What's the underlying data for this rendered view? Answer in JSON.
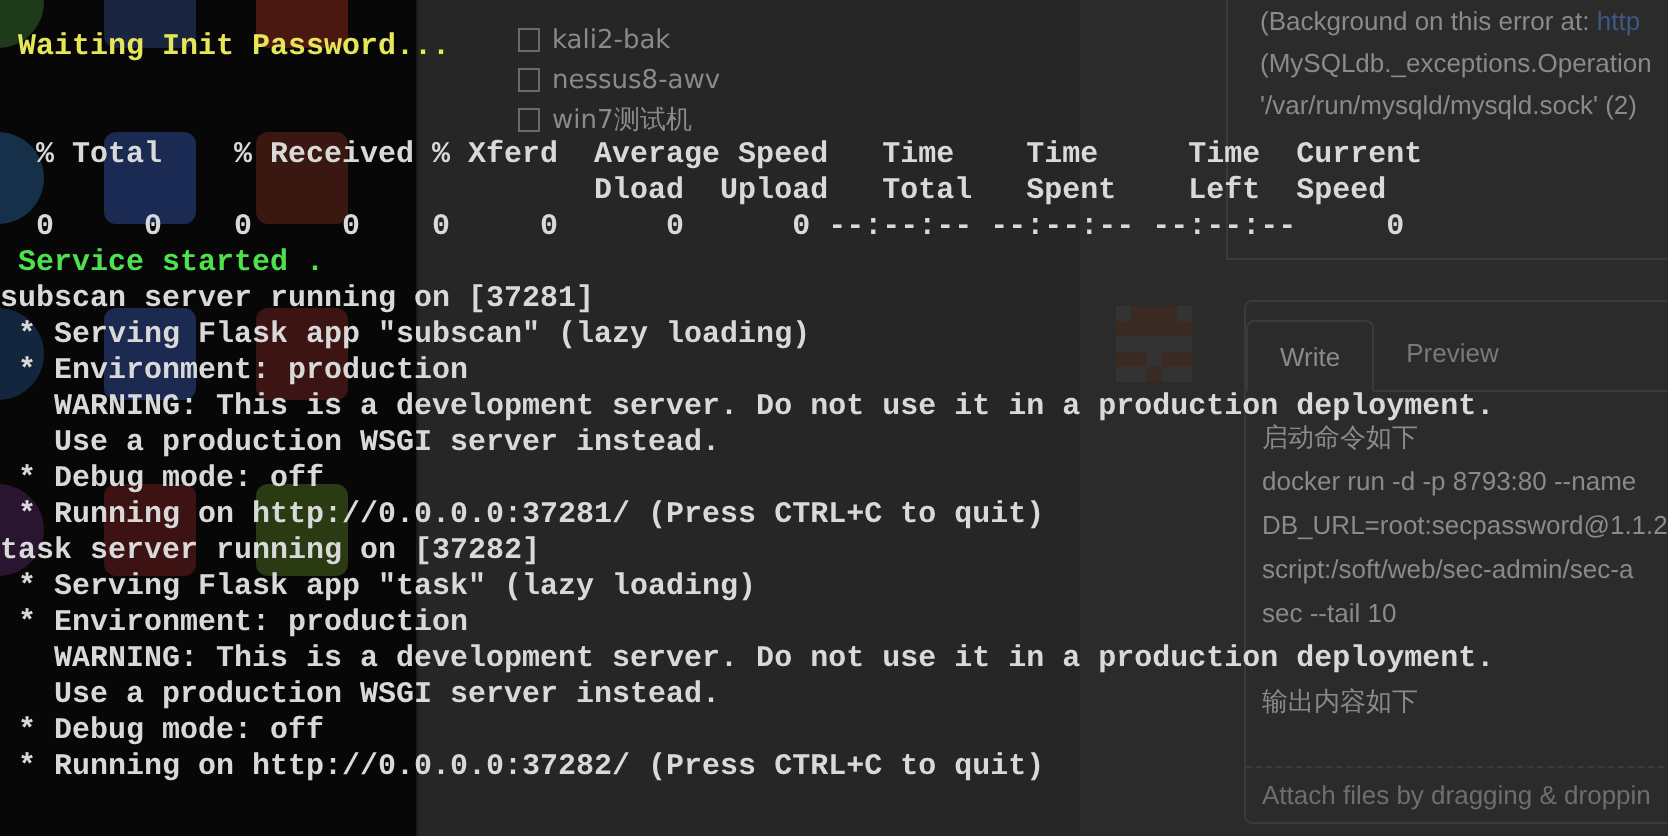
{
  "explorer": {
    "items": [
      {
        "label": "kali2-bak"
      },
      {
        "label": "nessus8-awv"
      },
      {
        "label": "win7测试机"
      }
    ]
  },
  "issue": {
    "error_lines": [
      {
        "text": "(Background on this error at: ",
        "link": "http"
      },
      {
        "text": "(MySQLdb._exceptions.Operation"
      },
      {
        "text": "'/var/run/mysqld/mysqld.sock' (2)"
      }
    ],
    "editor": {
      "tabs": [
        {
          "label": "Write",
          "selected": true
        },
        {
          "label": "Preview",
          "selected": false
        }
      ],
      "lines": [
        {
          "text": "启动命令如下"
        },
        {
          "text": "docker run -d -p 8793:80 --name"
        },
        {
          "text": "DB_URL=root:secpassword@1.1.2"
        },
        {
          "text": "script:/soft/web/sec-admin/sec-a"
        },
        {
          "text": "sec --tail 10"
        },
        {
          "kind": "blank"
        },
        {
          "text": "输出内容如下"
        }
      ],
      "attach_hint": "Attach files by dragging & droppin"
    }
  },
  "terminal": {
    "lines": [
      {
        "kind": "notice",
        "text": " Waiting Init Password..."
      },
      {
        "kind": "blank"
      },
      {
        "kind": "blank"
      },
      {
        "kind": "output",
        "text": "  % Total    % Received % Xferd  Average Speed   Time    Time     Time  Current"
      },
      {
        "kind": "output",
        "text": "                                 Dload  Upload   Total   Spent    Left  Speed"
      },
      {
        "kind": "output",
        "text": "  0     0    0     0    0     0      0      0 --:--:-- --:--:-- --:--:--     0"
      },
      {
        "kind": "success",
        "text": " Service started ."
      },
      {
        "kind": "output",
        "text": "subscan server running on [37281]"
      },
      {
        "kind": "output",
        "text": " * Serving Flask app \"subscan\" (lazy loading)"
      },
      {
        "kind": "output",
        "text": " * Environment: production"
      },
      {
        "kind": "output",
        "text": "   WARNING: This is a development server. Do not use it in a production deployment."
      },
      {
        "kind": "output",
        "text": "   Use a production WSGI server instead."
      },
      {
        "kind": "output",
        "text": " * Debug mode: off"
      },
      {
        "kind": "output",
        "text": " * Running on http://0.0.0.0:37281/ (Press CTRL+C to quit)"
      },
      {
        "kind": "output",
        "text": "task server running on [37282]"
      },
      {
        "kind": "output",
        "text": " * Serving Flask app \"task\" (lazy loading)"
      },
      {
        "kind": "output",
        "text": " * Environment: production"
      },
      {
        "kind": "output",
        "text": "   WARNING: This is a development server. Do not use it in a production deployment."
      },
      {
        "kind": "output",
        "text": "   Use a production WSGI server instead."
      },
      {
        "kind": "output",
        "text": " * Debug mode: off"
      },
      {
        "kind": "output",
        "text": " * Running on http://0.0.0.0:37282/ (Press CTRL+C to quit)"
      }
    ]
  }
}
